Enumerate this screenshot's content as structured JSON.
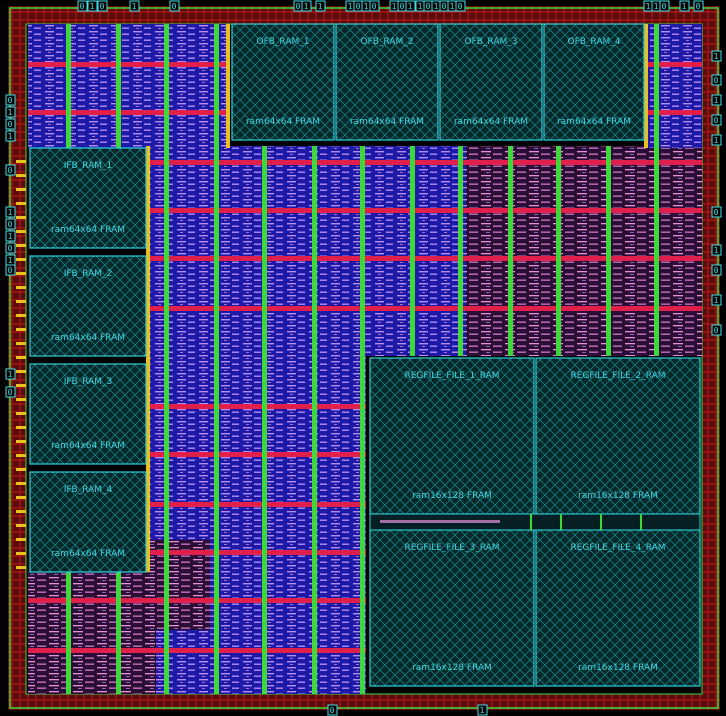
{
  "colors": {
    "background": "#000000",
    "macro_outline": "#2fd2dc",
    "macro_hatch": "#1aa8a8",
    "metal_blue": "#1d1aa8",
    "metal_violet": "#b58cf0",
    "metal_pink": "#e890d8",
    "power_rail_red": "#e0204a",
    "power_strap_green": "#3fd83a",
    "io_ring_red": "#b01818",
    "pin_yellow": "#e8c020",
    "pin_cyan": "#3fe0e8"
  },
  "macros": [
    {
      "id": "ofb-ram-1",
      "inst": "OFB_RAM_1",
      "cell": "ram64x64 FRAM"
    },
    {
      "id": "ofb-ram-2",
      "inst": "OFB_RAM_2",
      "cell": "ram64x64 FRAM"
    },
    {
      "id": "ofb-ram-3",
      "inst": "OFB_RAM_3",
      "cell": "ram64x64 FRAM"
    },
    {
      "id": "ofb-ram-4",
      "inst": "OFB_RAM_4",
      "cell": "ram64x64 FRAM"
    },
    {
      "id": "ifb-ram-1",
      "inst": "IFB_RAM_1",
      "cell": "ram64x64 FRAM"
    },
    {
      "id": "ifb-ram-2",
      "inst": "IFB_RAM_2",
      "cell": "ram64x64 FRAM"
    },
    {
      "id": "ifb-ram-3",
      "inst": "IFB_RAM_3",
      "cell": "ram64x64 FRAM"
    },
    {
      "id": "ifb-ram-4",
      "inst": "IFB_RAM_4",
      "cell": "ram64x64 FRAM"
    },
    {
      "id": "regfile-1",
      "inst": "REGFILE_FILE_1_RAM",
      "cell": "ram16x128 FRAM"
    },
    {
      "id": "regfile-2",
      "inst": "REGFILE_FILE_2_RAM",
      "cell": "ram16x128 FRAM"
    },
    {
      "id": "regfile-3",
      "inst": "REGFILE_FILE_3_RAM",
      "cell": "ram16x128 FRAM"
    },
    {
      "id": "regfile-4",
      "inst": "REGFILE_FILE_4_RAM",
      "cell": "ram16x128 FRAM"
    }
  ],
  "pins": {
    "top": [
      "0",
      "1",
      "0",
      "1",
      "0",
      "0",
      "1",
      "1",
      "1",
      "0",
      "1",
      "0",
      "1",
      "0",
      "1",
      "1",
      "0",
      "1",
      "0",
      "1",
      "0",
      "1",
      "1",
      "0",
      "1",
      "0"
    ],
    "bottom": [
      "0",
      "1"
    ],
    "left": [
      "0",
      "1",
      "0",
      "1",
      "0",
      "1",
      "0",
      "1",
      "0",
      "1",
      "0",
      "1",
      "0"
    ],
    "right": [
      "1",
      "0",
      "1",
      "0",
      "1",
      "0",
      "1",
      "0",
      "1",
      "0"
    ]
  }
}
